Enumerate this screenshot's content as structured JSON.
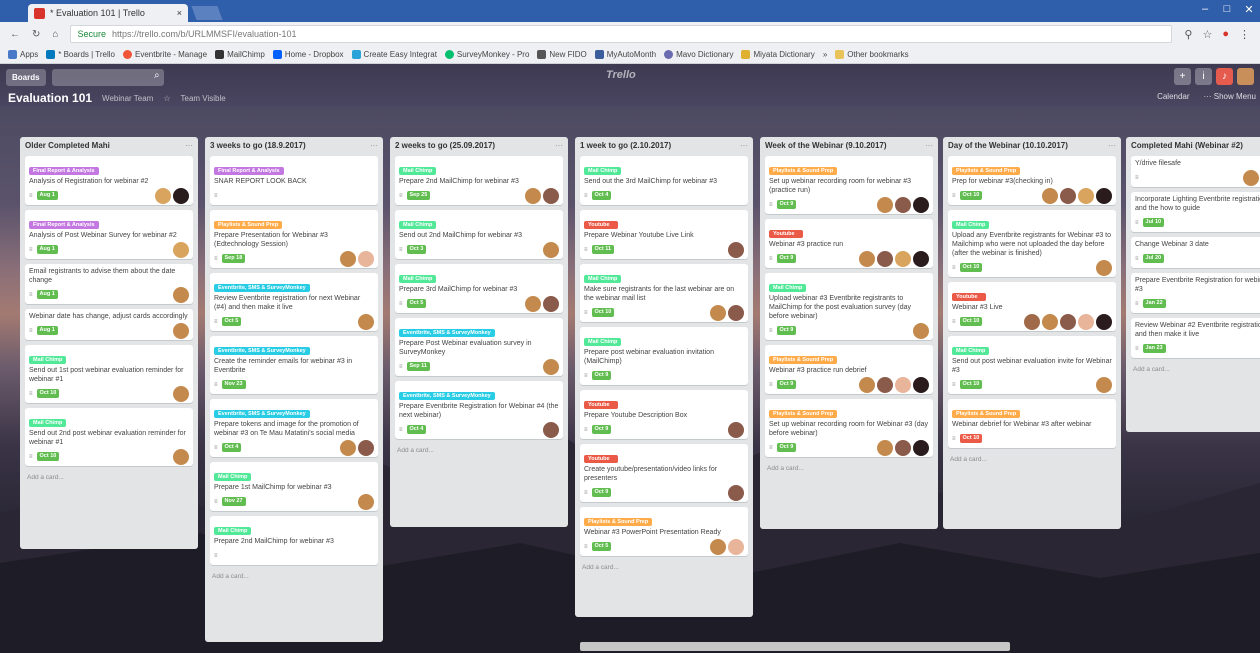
{
  "browser": {
    "tab_title": "* Evaluation 101 | Trello",
    "tab_close": "×",
    "url_secure": "Secure",
    "url": "https://trello.com/b/URLMMSFI/evaluation-101",
    "win": [
      "–",
      "□",
      "✕"
    ],
    "bookmarks": [
      "Apps",
      "* Boards | Trello",
      "Eventbrite - Manage",
      "MailChimp",
      "Home - Dropbox",
      "Create Easy Integrat",
      "SurveyMonkey - Pro",
      "New FIDO",
      "MyAutoMonth",
      "Mavo Dictionary",
      "Miyata Dictionary",
      "»",
      "Other bookmarks"
    ]
  },
  "header": {
    "boards": "Boards",
    "logo": "Trello",
    "board_title": "Evaluation 101",
    "board_sub": "Webinar Team",
    "visibility": "Team Visible",
    "calendar": "Calendar",
    "show_menu": "··· Show Menu"
  },
  "lists": [
    {
      "title": "Older Completed Mahi",
      "add": "Add a card...",
      "cards": [
        {
          "label": "Final Report & Analysis",
          "lc": "#c377e0",
          "title": "Analysis of Registration for webinar #2",
          "due": "Aug 1",
          "m": [
            "#d9a45e",
            "#2a1c1c"
          ]
        },
        {
          "label": "Final Report & Analysis",
          "lc": "#c377e0",
          "title": "Analysis of Post Webinar Survey for webinar #2",
          "due": "Aug 1",
          "m": [
            "#d9a45e"
          ]
        },
        {
          "title": "Email registrants to advise them about the date change",
          "due": "Aug 1",
          "m": [
            "#c48a4d"
          ]
        },
        {
          "title": "Webinar date has change, adjust cards accordingly",
          "due": "Aug 1",
          "m": [
            "#c48a4d"
          ]
        },
        {
          "label": "Mail Chimp",
          "lc": "#51e898",
          "title": "Send out 1st post webinar evaluation reminder for webinar #1",
          "due": "Oct 10",
          "m": [
            "#c48a4d"
          ]
        },
        {
          "label": "Mail Chimp",
          "lc": "#51e898",
          "title": "Send out 2nd post webinar evaluation reminder for webinar #1",
          "due": "Oct 10",
          "m": [
            "#c48a4d"
          ]
        }
      ]
    },
    {
      "title": "3 weeks to go (18.9.2017)",
      "add": "Add a card...",
      "cards": [
        {
          "label": "Final Report & Analysis",
          "lc": "#c377e0",
          "title": "SNAR REPORT LOOK BACK"
        },
        {
          "label": "Playlists & Sound Prep",
          "lc": "#ffab4a",
          "title": "Prepare Presentation for Webinar #3 (Edtechnology Session)",
          "due": "Sep 18",
          "m": [
            "#c48a4d",
            "#e8b49a"
          ]
        },
        {
          "label": "Eventbrite, SMS & SurveyMonkey",
          "lc": "#29cce5",
          "title": "Review Eventbrite registration for next Webinar (#4) and then make it live",
          "due": "Oct 5",
          "m": [
            "#c48a4d"
          ]
        },
        {
          "label": "Eventbrite, SMS & SurveyMonkey",
          "lc": "#29cce5",
          "title": "Create the reminder emails for webinar #3 in Eventbrite",
          "due": "Nov 23",
          "m": []
        },
        {
          "label": "Eventbrite, SMS & SurveyMonkey",
          "lc": "#29cce5",
          "title": "Prepare tokens and image for the promotion of webinar #3 on Te Mau Matatini's social media",
          "due": "Oct 4",
          "m": [
            "#c48a4d",
            "#8a5a4a"
          ]
        },
        {
          "label": "Mail Chimp",
          "lc": "#51e898",
          "title": "Prepare 1st MailChimp for webinar #3",
          "due": "Nov 27",
          "m": [
            "#c48a4d"
          ]
        },
        {
          "label": "Mail Chimp",
          "lc": "#51e898",
          "title": "Prepare 2nd MailChimp for webinar #3",
          "m": []
        }
      ]
    },
    {
      "title": "2 weeks to go (25.09.2017)",
      "add": "Add a card...",
      "cards": [
        {
          "label": "Mail Chimp",
          "lc": "#51e898",
          "title": "Prepare 2nd MailChimp for webinar #3",
          "due": "Sep 25",
          "m": [
            "#c48a4d",
            "#8a5a4a"
          ]
        },
        {
          "label": "Mail Chimp",
          "lc": "#51e898",
          "title": "Send out 2nd MailChimp for webinar #3",
          "due": "Oct 3",
          "m": [
            "#c48a4d"
          ]
        },
        {
          "label": "Mail Chimp",
          "lc": "#51e898",
          "title": "Prepare 3rd MailChimp for webinar #3",
          "due": "Oct 5",
          "m": [
            "#c48a4d",
            "#8a5a4a"
          ]
        },
        {
          "label": "Eventbrite, SMS & SurveyMonkey",
          "lc": "#29cce5",
          "title": "Prepare Post Webinar evaluation survey in SurveyMonkey",
          "due": "Sep 11",
          "m": [
            "#c48a4d"
          ]
        },
        {
          "label": "Eventbrite, SMS & SurveyMonkey",
          "lc": "#29cce5",
          "title": "Prepare Eventbrite Registration for Webinar #4 (the next webinar)",
          "due": "Oct 4",
          "m": [
            "#8a5a4a"
          ]
        }
      ]
    },
    {
      "title": "1 week to go (2.10.2017)",
      "add": "Add a card...",
      "cards": [
        {
          "label": "Mail Chimp",
          "lc": "#51e898",
          "title": "Send out the 3rd MailChimp for webinar #3",
          "due": "Oct 4",
          "m": []
        },
        {
          "label": "Youtube",
          "lc": "#eb5a46",
          "title": "Prepare Webinar Youtube Live Link",
          "due": "Oct 11",
          "m": [
            "#8a5a4a"
          ]
        },
        {
          "label": "Mail Chimp",
          "lc": "#51e898",
          "title": "Make sure registrants for the last webinar are on the webinar mail list",
          "due": "Oct 10",
          "m": [
            "#c48a4d",
            "#8a5a4a"
          ]
        },
        {
          "label": "Mail Chimp",
          "lc": "#51e898",
          "title": "Prepare post webinar evaluation invitation (MailChimp)",
          "due": "Oct 9",
          "m": []
        },
        {
          "label": "Youtube",
          "lc": "#eb5a46",
          "title": "Prepare Youtube Description Box",
          "due": "Oct 9",
          "m": [
            "#8a5a4a"
          ]
        },
        {
          "label": "Youtube",
          "lc": "#eb5a46",
          "title": "Create youtube/presentation/video links for presenters",
          "due": "Oct 9",
          "m": [
            "#8a5a4a"
          ]
        },
        {
          "label": "Playlists & Sound Prep",
          "lc": "#ffab4a",
          "title": "Webinar #3 PowerPoint Presentation Ready",
          "due": "Oct 5",
          "m": [
            "#c48a4d",
            "#e8b49a"
          ]
        }
      ]
    },
    {
      "title": "Week of the Webinar (9.10.2017)",
      "add": "Add a card...",
      "cards": [
        {
          "label": "Playlists & Sound Prep",
          "lc": "#ffab4a",
          "title": "Set up webinar recording room for webinar #3 (practice run)",
          "due": "Oct 9",
          "m": [
            "#c48a4d",
            "#8a5a4a",
            "#2a1c1c"
          ]
        },
        {
          "label": "Youtube",
          "lc": "#eb5a46",
          "title": "Webinar #3 practice run",
          "due": "Oct 9",
          "m": [
            "#c48a4d",
            "#8a5a4a",
            "#d9a45e",
            "#2a1c1c"
          ]
        },
        {
          "label": "Mail Chimp",
          "lc": "#51e898",
          "title": "Upload webinar #3 Eventbrite registrants to MailChimp for the post evaluation survey (day before webinar)",
          "due": "Oct 9",
          "m": [
            "#c48a4d"
          ]
        },
        {
          "label": "Playlists & Sound Prep",
          "lc": "#ffab4a",
          "title": "Webinar #3 practice run debrief",
          "due": "Oct 9",
          "m": [
            "#c48a4d",
            "#8a5a4a",
            "#e8b49a",
            "#2a1c1c"
          ]
        },
        {
          "label": "Playlists & Sound Prep",
          "lc": "#ffab4a",
          "title": "Set up webinar recording room for Webinar #3 (day before webinar)",
          "due": "Oct 9",
          "m": [
            "#c48a4d",
            "#8a5a4a",
            "#2a1c1c"
          ]
        }
      ]
    },
    {
      "title": "Day of the Webinar (10.10.2017)",
      "add": "Add a card...",
      "cards": [
        {
          "label": "Playlists & Sound Prep",
          "lc": "#ffab4a",
          "title": "Prep for webinar #3(checking in)",
          "due": "Oct 10",
          "m": [
            "#c48a4d",
            "#8a5a4a",
            "#d9a45e",
            "#2a1c1c"
          ]
        },
        {
          "label": "Mail Chimp",
          "lc": "#51e898",
          "title": "Upload any Eventbrite registrants for Webinar #3 to Mailchimp who were not uploaded the day before (after the webinar is finished)",
          "due": "Oct 10",
          "m": [
            "#c48a4d"
          ]
        },
        {
          "label": "Youtube",
          "lc": "#eb5a46",
          "title": "Webinar #3 Live",
          "due": "Oct 10",
          "m": [
            "#a06a4a",
            "#c48a4d",
            "#8a5a4a",
            "#e8b49a",
            "#2a1c1c"
          ]
        },
        {
          "label": "Mail Chimp",
          "lc": "#51e898",
          "title": "Send out post webinar evaluation invite for Webinar #3",
          "due": "Oct 10",
          "m": [
            "#c48a4d"
          ]
        },
        {
          "label": "Playlists & Sound Prep",
          "lc": "#ffab4a",
          "title": "Webinar debrief for Webinar #3 after webinar",
          "due": "Oct 10",
          "red": true,
          "m": []
        }
      ]
    },
    {
      "title": "Completed Mahi (Webinar #2)",
      "add": "Add a card...",
      "cards": [
        {
          "title": "Y/drive filesafe",
          "due": "",
          "m": [
            "#c48a4d",
            "#2a1c1c"
          ]
        },
        {
          "title": "Incorporate Lighting Eventbrite registration and the how to guide",
          "due": "Jul 10",
          "m": []
        },
        {
          "title": "Change Webinar 3 date",
          "due": "Jul 20",
          "m": []
        },
        {
          "title": "Prepare Eventbrite Registration for webinar #3",
          "due": "Jan 22",
          "m": []
        },
        {
          "title": "Review Webinar #2 Eventbrite registration and then make it live",
          "due": "Jan 23",
          "m": []
        }
      ]
    }
  ],
  "colors": {
    "header": "#4a4560",
    "list": "#e2e4e6",
    "green": "#61bd4f",
    "purple": "#c377e0",
    "orange": "#ffab4a",
    "sky": "#29cce5",
    "red": "#eb5a46"
  }
}
